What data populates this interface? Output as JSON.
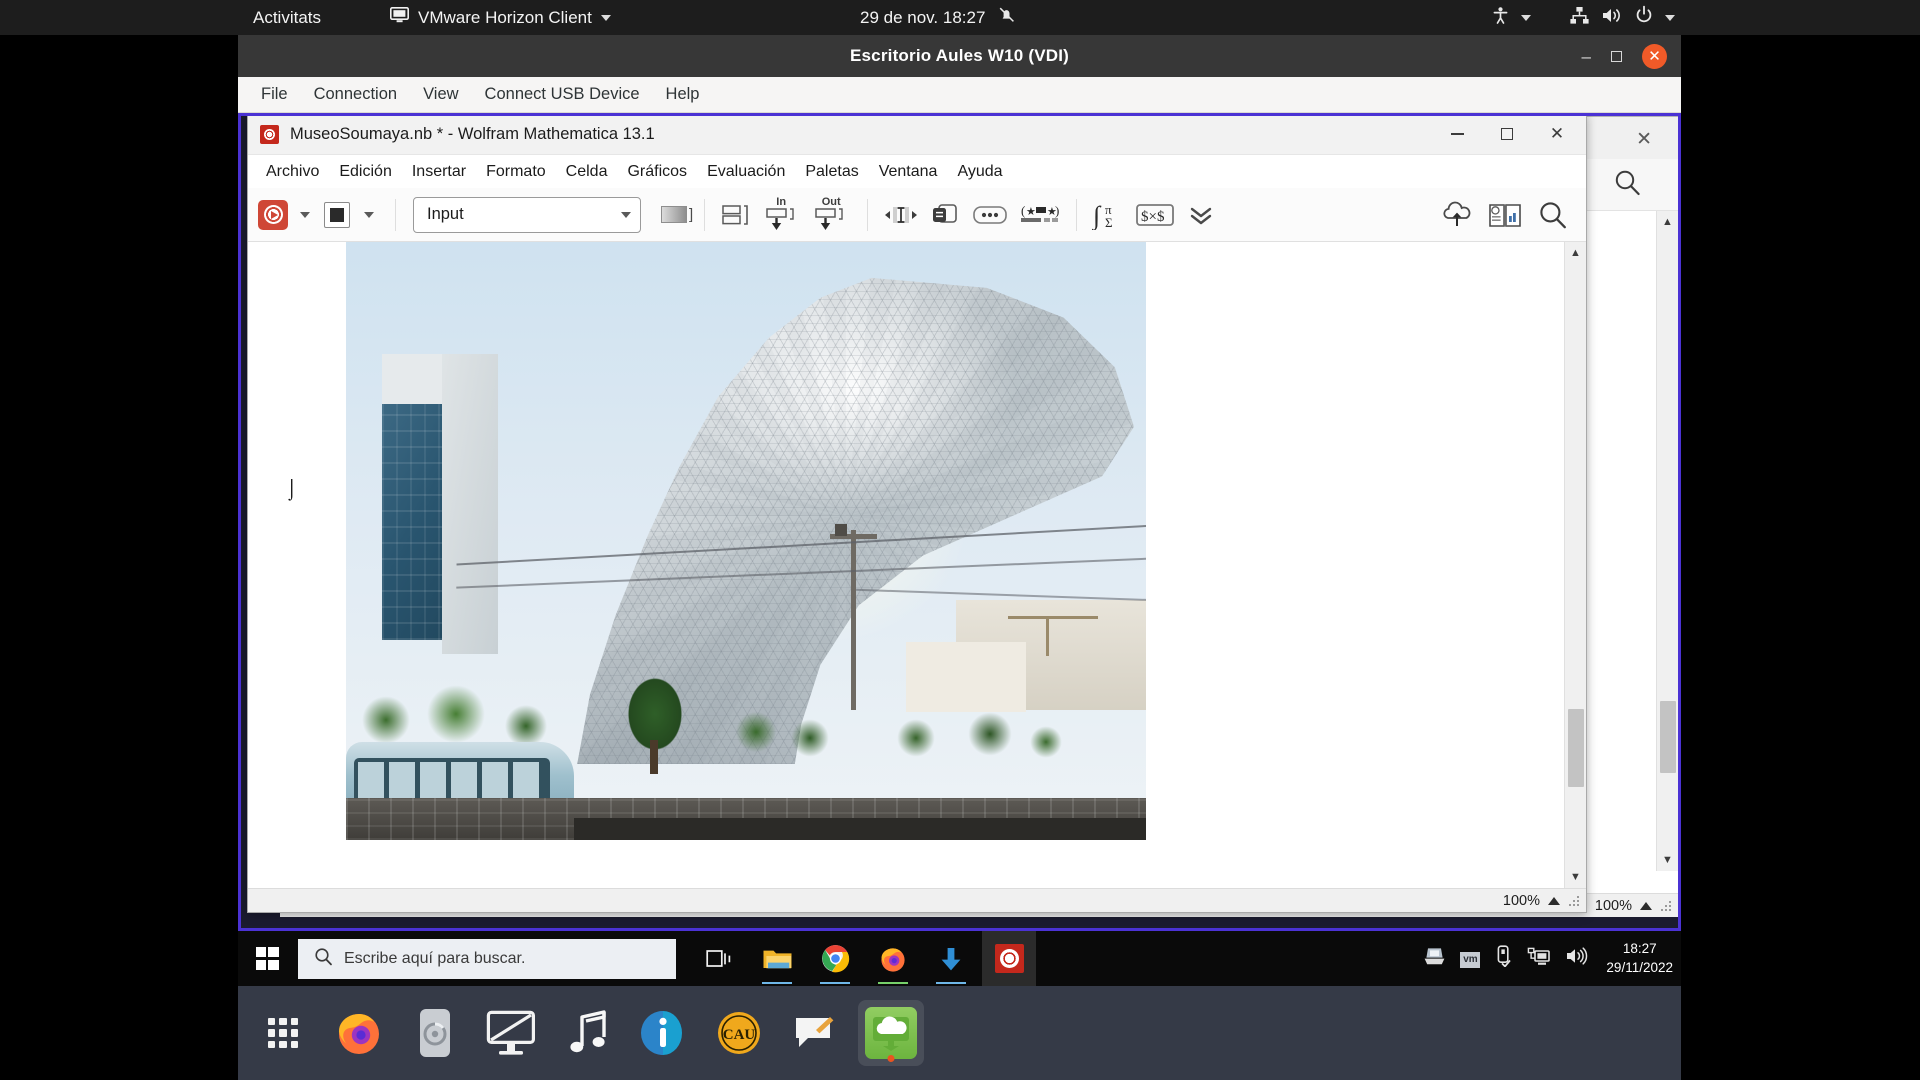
{
  "gnome": {
    "activities": "Activitats",
    "app_menu": {
      "label": "VMware Horizon Client",
      "icon": "display-icon"
    },
    "clock": "29 de nov.  18:27",
    "notifications_icon": "bell-muted-icon",
    "right_icons": [
      "accessibility-icon",
      "network-icon",
      "volume-icon",
      "power-icon"
    ]
  },
  "vmware": {
    "title": "Escritorio Aules W10 (VDI)",
    "menu": [
      "File",
      "Connection",
      "View",
      "Connect USB Device",
      "Help"
    ],
    "window_buttons": {
      "minimize": "–",
      "maximize": "☐",
      "close": "✕"
    },
    "border_color": "#4b32d4"
  },
  "mathematica": {
    "title": "MuseoSoumaya.nb * - Wolfram Mathematica 13.1",
    "menu": [
      "Archivo",
      "Edición",
      "Insertar",
      "Formato",
      "Celda",
      "Gráficos",
      "Evaluación",
      "Paletas",
      "Ventana",
      "Ayuda"
    ],
    "toolbar": {
      "evaluate_icon": "wolfram-spikey-run-icon",
      "evaluate_caret": "chevron-down-icon",
      "abort_icon": "stop-square-icon",
      "abort_caret": "chevron-down-icon",
      "style_selected": "Input",
      "style_caret": "chevron-down-icon",
      "gradient_icon": "cell-shading-icon",
      "cell_group_icon": "cell-bracket-icon",
      "in_label": "In",
      "out_label": "Out",
      "in_icon": "insert-input-cell-icon",
      "out_icon": "insert-output-cell-icon",
      "text_width_icon": "horizontal-resize-icon",
      "duplicate_icon": "duplicate-cell-icon",
      "more_icon": "ellipsis-icon",
      "format_icon": "star-format-icon",
      "math_palette_icon": "integral-sigma-icon",
      "special_chars_icon": "special-characters-icon",
      "expand_icon": "double-chevron-down-icon",
      "cloud_icon": "cloud-upload-icon",
      "docs_icon": "documentation-book-icon",
      "search_icon": "search-icon"
    },
    "notebook": {
      "cursor": "text-ibeam-cursor",
      "image_alt": "Museo Soumaya building photograph"
    },
    "status": {
      "zoom": "100%",
      "zoom_caret": "triangle-up-icon",
      "grip": "resize-grip"
    },
    "rear_window": {
      "zoom": "100%",
      "close_icon": "close-icon",
      "docs_icon": "documentation-book-icon",
      "search_icon": "search-icon"
    }
  },
  "windows_taskbar": {
    "start_icon": "windows-logo-icon",
    "search_placeholder": "Escribe aquí para buscar.",
    "search_icon": "search-icon",
    "apps": [
      {
        "name": "task-view-icon",
        "open": false
      },
      {
        "name": "file-explorer-icon",
        "open": true
      },
      {
        "name": "google-chrome-icon",
        "open": true
      },
      {
        "name": "firefox-icon",
        "open": true
      },
      {
        "name": "download-arrow-icon",
        "open": true
      },
      {
        "name": "mathematica-icon",
        "open": true,
        "active": true
      }
    ],
    "tray": [
      "scanner-icon",
      "vmware-tools-icon",
      "usb-eject-icon",
      "network-icon",
      "volume-icon"
    ],
    "clock_time": "18:27",
    "clock_date": "29/11/2022"
  },
  "ubuntu_dock": {
    "items": [
      {
        "name": "show-applications-icon",
        "running": false
      },
      {
        "name": "firefox-icon",
        "running": false
      },
      {
        "name": "software-updater-icon",
        "running": false
      },
      {
        "name": "remote-desktop-icon",
        "running": false
      },
      {
        "name": "music-player-icon",
        "running": false
      },
      {
        "name": "info-help-icon",
        "running": false
      },
      {
        "name": "cau-support-icon",
        "running": false
      },
      {
        "name": "feedback-note-icon",
        "running": false
      },
      {
        "name": "vmware-horizon-client-icon",
        "running": true
      }
    ]
  },
  "colors": {
    "gnome_bar": "#1d1d1d",
    "vmware_chrome": "#373737",
    "vmware_border": "#4b32d4",
    "wolfram_red": "#cf4736",
    "taskbar": "#0a0a0a",
    "dock": "#353a47",
    "ubuntu_orange": "#e95420"
  }
}
